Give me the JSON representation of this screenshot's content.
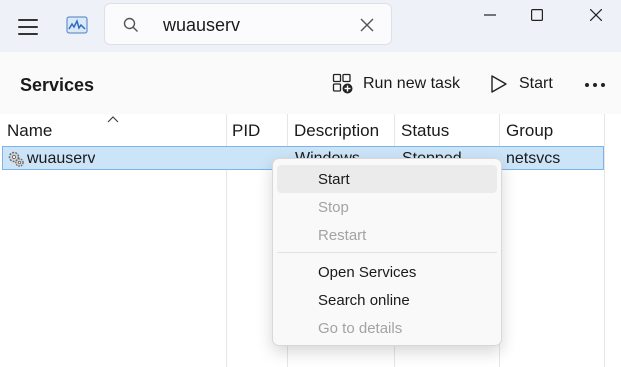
{
  "search": {
    "value": "wuauserv"
  },
  "header": {
    "title": "Services",
    "run_new_task_label": "Run new task",
    "start_label": "Start"
  },
  "table": {
    "columns": [
      "Name",
      "PID",
      "Description",
      "Status",
      "Group"
    ],
    "sorted_column": "Name",
    "rows": [
      {
        "name": "wuauserv",
        "pid": "",
        "description": "Windows ...",
        "status": "Stopped",
        "group": "netsvcs",
        "selected": true
      }
    ]
  },
  "context_menu": {
    "items": [
      {
        "label": "Start",
        "enabled": true,
        "highlighted": true
      },
      {
        "label": "Stop",
        "enabled": false
      },
      {
        "label": "Restart",
        "enabled": false
      },
      {
        "label": "Open Services",
        "enabled": true
      },
      {
        "label": "Search online",
        "enabled": true
      },
      {
        "label": "Go to details",
        "enabled": false
      }
    ]
  },
  "colors": {
    "titlebar_bg": "#eef2f8",
    "selection_bg": "#cce4f7",
    "selection_border": "#7eb4ea",
    "disabled_text": "#a3a3a3"
  }
}
